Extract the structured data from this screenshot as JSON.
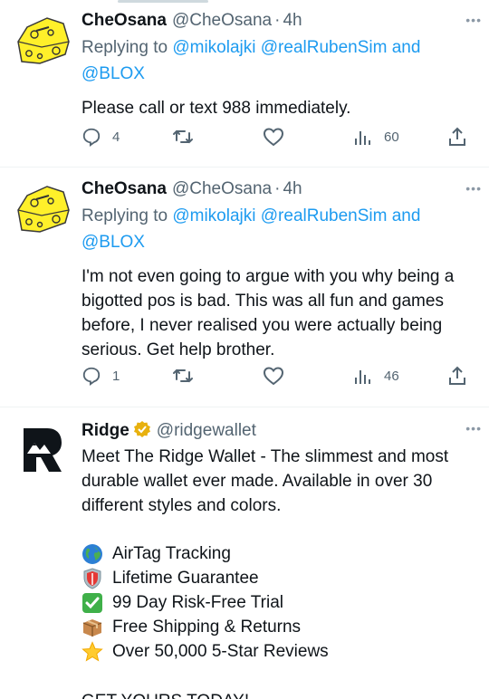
{
  "tweets": [
    {
      "name": "CheOsana",
      "handle": "@CheOsana",
      "dot": "·",
      "time": "4h",
      "replying_prefix": "Replying to",
      "mention1": "@mikolajki",
      "mention2": "@realRubenSim",
      "and": "and",
      "mention3": "@BLOX",
      "text": "Please call or text 988 immediately.",
      "replies": "4",
      "views": "60",
      "more": "•••",
      "avatar_icon": "cheese-avatar-icon"
    },
    {
      "name": "CheOsana",
      "handle": "@CheOsana",
      "dot": "·",
      "time": "4h",
      "replying_prefix": "Replying to",
      "mention1": "@mikolajki",
      "mention2": "@realRubenSim",
      "and": "and",
      "mention3": "@BLOX",
      "text": "I'm not even going to argue with you why being a bigotted pos is bad. This was all fun and games before, I never realised you were actually being serious. Get help brother.",
      "replies": "1",
      "views": "46",
      "more": "•••",
      "avatar_icon": "cheese-avatar-icon"
    }
  ],
  "ad": {
    "name": "Ridge",
    "handle": "@ridgewallet",
    "more": "•••",
    "text": "Meet The Ridge Wallet - The slimmest and most durable wallet ever made. Available in over 30 different styles and colors.",
    "features": [
      {
        "icon": "globe-icon",
        "label": "AirTag Tracking"
      },
      {
        "icon": "shield-icon",
        "label": "Lifetime Guarantee"
      },
      {
        "icon": "check-box-icon",
        "label": "99 Day Risk-Free Trial"
      },
      {
        "icon": "package-icon",
        "label": "Free Shipping & Returns"
      },
      {
        "icon": "star-icon",
        "label": "Over 50,000 5-Star Reviews"
      }
    ],
    "cta": "GET YOURS TODAY!"
  },
  "colors": {
    "accent": "#1d9bf0",
    "secondary_text": "#536471",
    "cheese_yellow": "#ffee33"
  }
}
